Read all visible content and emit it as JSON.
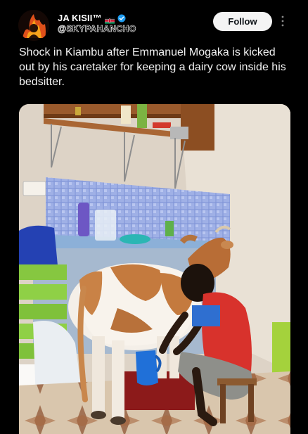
{
  "post": {
    "author": {
      "display_name": "JA KISII™",
      "handle": "@SKYPAHANCHO",
      "flag_icon": "kenya-flag-icon",
      "verified_icon": "verified-badge-icon"
    },
    "follow_label": "Follow",
    "more_icon": "more-vertical-icon",
    "text": "Shock in Kiambu after Emmanuel Mogaka is kicked out by his caretaker for keeping a dairy cow inside his bedsitter."
  },
  "colors": {
    "background": "#000000",
    "follow_bg": "#f4f4f4",
    "verified": "#1d9bf0"
  }
}
